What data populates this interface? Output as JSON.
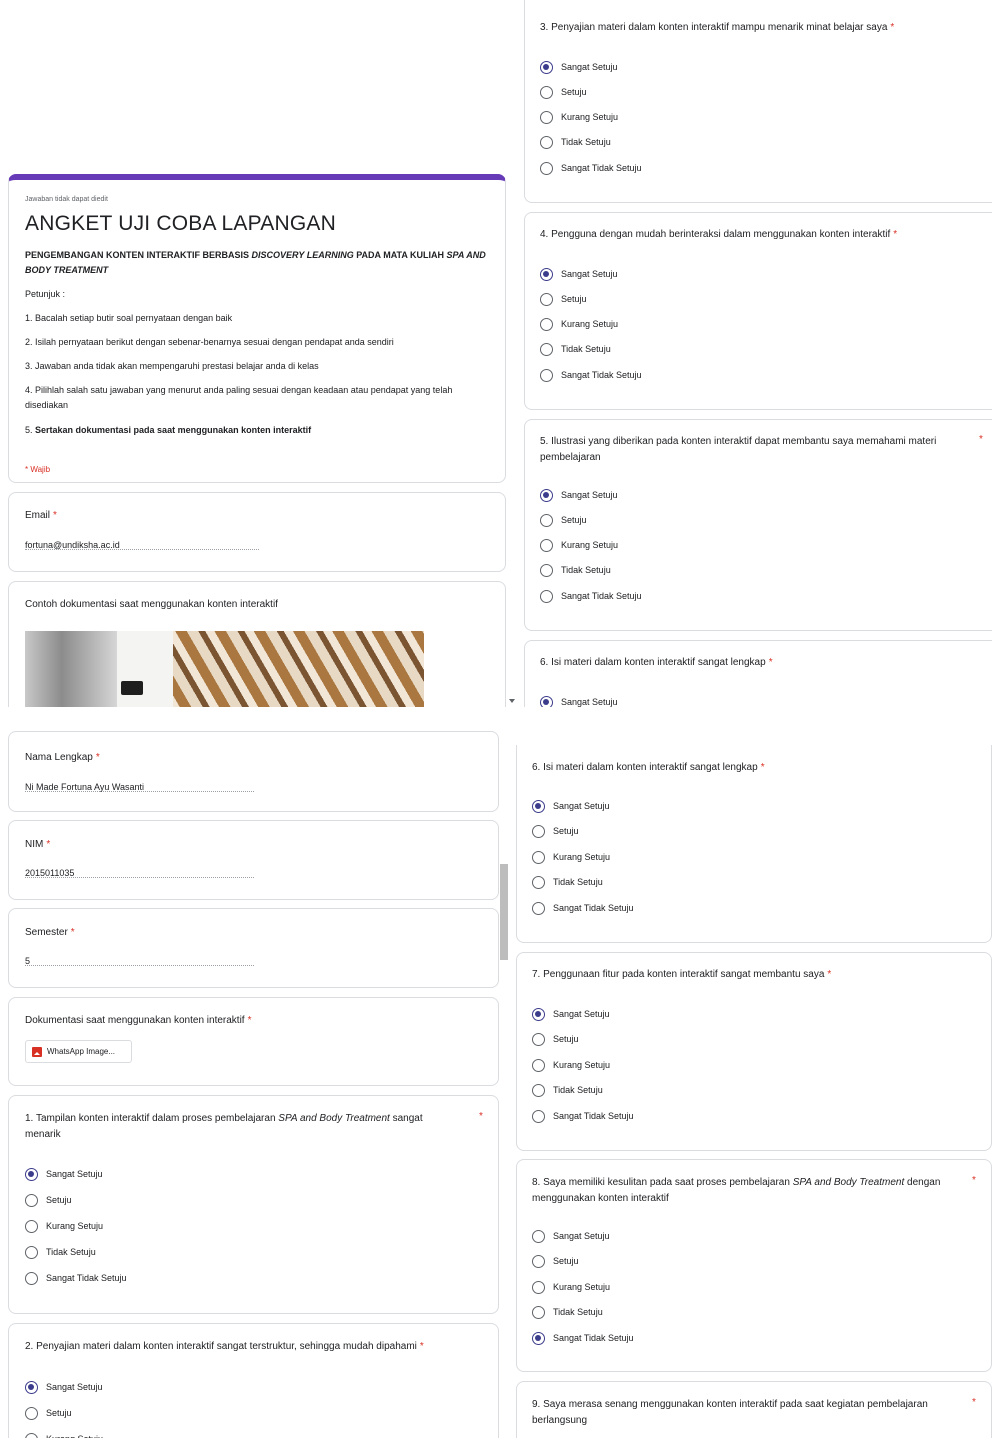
{
  "options": [
    "Sangat Setuju",
    "Setuju",
    "Kurang Setuju",
    "Tidak Setuju",
    "Sangat Tidak Setuju"
  ],
  "header": {
    "notice": "Jawaban tidak dapat diedit",
    "title": "ANGKET UJI COBA LAPANGAN",
    "subtitle_a": "PENGEMBANGAN KONTEN INTERAKTIF BERBASIS ",
    "subtitle_b": "DISCOVERY LEARNING",
    "subtitle_c": " PADA MATA KULIAH ",
    "subtitle_d": "SPA AND BODY TREATMENT",
    "petunjuk": "Petunjuk :",
    "items": [
      "1. Bacalah setiap butir soal pernyataan dengan baik",
      "2. Isilah pernyataan berikut dengan sebenar-benarnya sesuai dengan pendapat anda sendiri",
      "3. Jawaban anda tidak akan mempengaruhi prestasi belajar anda di kelas",
      "4. Pilihlah salah satu jawaban yang menurut anda paling sesuai dengan keadaan atau pendapat yang telah disediakan"
    ],
    "item5_prefix": "5. ",
    "item5_bold": "Sertakan dokumentasi pada saat menggunakan konten interaktif",
    "wajib": "* Wajib"
  },
  "email": {
    "label": "Email",
    "value": "fortuna@undiksha.ac.id"
  },
  "contoh": {
    "label": "Contoh dokumentasi saat menggunakan konten interaktif"
  },
  "nama": {
    "label": "Nama Lengkap",
    "value": "Ni Made Fortuna Ayu Wasanti"
  },
  "nim": {
    "label": "NIM",
    "value": "2015011035"
  },
  "semester": {
    "label": "Semester",
    "value": "5"
  },
  "dok": {
    "label": "Dokumentasi saat menggunakan konten interaktif",
    "file": "WhatsApp Image..."
  },
  "q1": {
    "a": "1. Tampilan konten interaktif dalam proses pembelajaran ",
    "b": "SPA and Body Treatment",
    "c": " sangat menarik"
  },
  "q2": {
    "text": "2. Penyajian materi dalam konten interaktif sangat terstruktur, sehingga mudah dipahami"
  },
  "q3": {
    "text": "3. Penyajian materi dalam konten interaktif mampu menarik minat belajar saya"
  },
  "q4": {
    "text": "4. Pengguna dengan mudah berinteraksi dalam menggunakan konten interaktif"
  },
  "q5": {
    "text": "5. Ilustrasi yang diberikan pada konten interaktif dapat membantu saya memahami materi pembelajaran"
  },
  "q6": {
    "text": "6. Isi materi dalam konten interaktif sangat lengkap"
  },
  "q7": {
    "text": "7. Penggunaan fitur pada konten interaktif sangat membantu saya"
  },
  "q8": {
    "a": "8. Saya memiliki kesulitan pada saat proses pembelajaran ",
    "b": "SPA and Body Treatment",
    "c": " dengan menggunakan konten interaktif"
  },
  "q9": {
    "text": "9. Saya merasa senang menggunakan konten interaktif pada saat kegiatan pembelajaran berlangsung"
  },
  "selected": {
    "q1": "Sangat Setuju",
    "q2": "Sangat Setuju",
    "q3": "Sangat Setuju",
    "q4": "Sangat Setuju",
    "q5": "Sangat Setuju",
    "q6": "Sangat Setuju",
    "q7": "Sangat Setuju",
    "q8": "Sangat Tidak Setuju"
  },
  "colors": {
    "accent": "#673ab7",
    "required": "#d93025",
    "radio": "#3c3c8c"
  }
}
